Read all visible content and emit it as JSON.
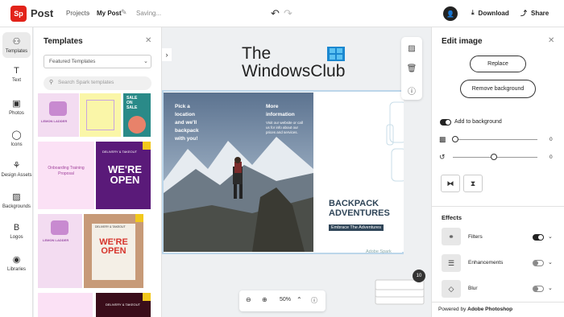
{
  "topbar": {
    "logo_mark": "Sp",
    "logo_word": "Post",
    "breadcrumb_projects": "Projects",
    "breadcrumb_sep": "›",
    "breadcrumb_current": "My Post",
    "status": "Saving...",
    "download_label": "Download",
    "share_label": "Share"
  },
  "rail": {
    "items": [
      {
        "label": "Templates",
        "icon": "templates-icon"
      },
      {
        "label": "Text",
        "icon": "text-icon"
      },
      {
        "label": "Photos",
        "icon": "photos-icon"
      },
      {
        "label": "Icons",
        "icon": "icons-icon"
      },
      {
        "label": "Design Assets",
        "icon": "design-assets-icon"
      },
      {
        "label": "Backgrounds",
        "icon": "backgrounds-icon"
      },
      {
        "label": "Logos",
        "icon": "logos-icon"
      },
      {
        "label": "Libraries",
        "icon": "libraries-icon"
      }
    ]
  },
  "templates_panel": {
    "title": "Templates",
    "filter_value": "Featured Templates",
    "search_placeholder": "Search Spark templates",
    "thumbs": {
      "sale_line1": "SALE",
      "sale_line2": "ON",
      "sale_line3": "SALE",
      "open_title": "WE'RE OPEN",
      "open_title2": "WE'RE OPEN",
      "delivery": "DELIVERY & TAKEOUT",
      "delivery2": "DELIVERY & TAKEOUT",
      "delivery3": "DELIVERY & TAKEOUT",
      "lemon_title": "LEMON LADDER",
      "lemon_title2": "LEMON LADDER",
      "pink_title": "Onboarding Training Proposal"
    }
  },
  "canvas": {
    "watermark_line1": "The",
    "watermark_line2": "WindowsClub",
    "photo_text_left": [
      "Pick a",
      "location",
      "and we'll",
      "backpack",
      "with you!"
    ],
    "photo_text_right": [
      "More",
      "information"
    ],
    "photo_subtext": "Visit our website or call us for info about our prices and services.",
    "poster_title_1": "BACKPACK",
    "poster_title_2": "ADVENTURES",
    "poster_tagline": "Embrace The Adventures",
    "brand_mark": "Adobe Spark",
    "zoom": "50%",
    "page_count": "10"
  },
  "edit_panel": {
    "title": "Edit image",
    "replace_label": "Replace",
    "remove_bg_label": "Remove background",
    "add_to_background_label": "Add to background",
    "opacity_value": "0",
    "rotate_value": "0",
    "effects_title": "Effects",
    "effects": [
      {
        "label": "Filters",
        "on": true
      },
      {
        "label": "Enhancements",
        "on": false
      },
      {
        "label": "Blur",
        "on": false
      }
    ],
    "powered_prefix": "Powered by ",
    "powered_brand": "Adobe Photoshop"
  },
  "colors": {
    "accent": "#e2231a",
    "poster_navy": "#2f4558",
    "frame": "#bcd6ea"
  }
}
